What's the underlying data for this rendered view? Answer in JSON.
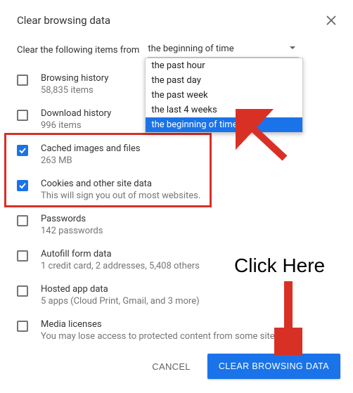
{
  "dialog": {
    "title": "Clear browsing data",
    "prompt": "Clear the following items from",
    "selectedRange": "the beginning of time"
  },
  "dropdown": {
    "options": [
      "the past hour",
      "the past day",
      "the past week",
      "the last 4 weeks",
      "the beginning of time"
    ]
  },
  "items": [
    {
      "label": "Browsing history",
      "sub": "58,835 items",
      "checked": false
    },
    {
      "label": "Download history",
      "sub": "996 items",
      "checked": false
    },
    {
      "label": "Cached images and files",
      "sub": "263 MB",
      "checked": true
    },
    {
      "label": "Cookies and other site data",
      "sub": "This will sign you out of most websites.",
      "checked": true
    },
    {
      "label": "Passwords",
      "sub": "142 passwords",
      "checked": false
    },
    {
      "label": "Autofill form data",
      "sub": "1 credit card, 2 addresses, 5,408 others",
      "checked": false
    },
    {
      "label": "Hosted app data",
      "sub": "5 apps (Cloud Print, Gmail, and 3 more)",
      "checked": false
    },
    {
      "label": "Media licenses",
      "sub": "You may lose access to protected content from some sites.",
      "checked": false
    }
  ],
  "actions": {
    "cancel": "CANCEL",
    "confirm": "CLEAR BROWSING DATA"
  },
  "annotation": {
    "clickHere": "Click Here"
  }
}
